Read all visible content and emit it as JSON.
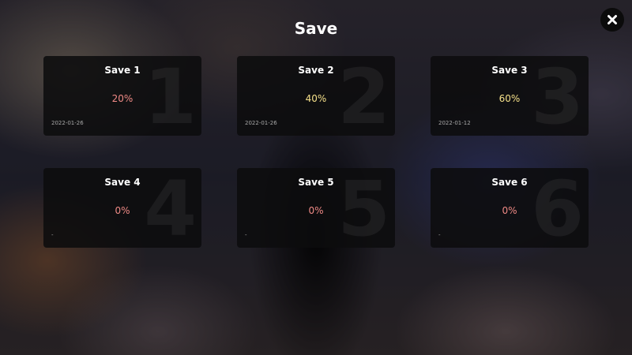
{
  "title": "Save",
  "close_icon": "close-icon",
  "colors": {
    "low_progress": "#f08a86",
    "high_progress": "#f5e08a"
  },
  "slots": [
    {
      "label": "Save 1",
      "number": "1",
      "progress": "20%",
      "date": "2022-01-26",
      "tone": "low"
    },
    {
      "label": "Save 2",
      "number": "2",
      "progress": "40%",
      "date": "2022-01-26",
      "tone": "high"
    },
    {
      "label": "Save 3",
      "number": "3",
      "progress": "60%",
      "date": "2022-01-12",
      "tone": "high"
    },
    {
      "label": "Save 4",
      "number": "4",
      "progress": "0%",
      "date": "-",
      "tone": "low"
    },
    {
      "label": "Save 5",
      "number": "5",
      "progress": "0%",
      "date": "-",
      "tone": "low"
    },
    {
      "label": "Save 6",
      "number": "6",
      "progress": "0%",
      "date": "-",
      "tone": "low"
    }
  ]
}
